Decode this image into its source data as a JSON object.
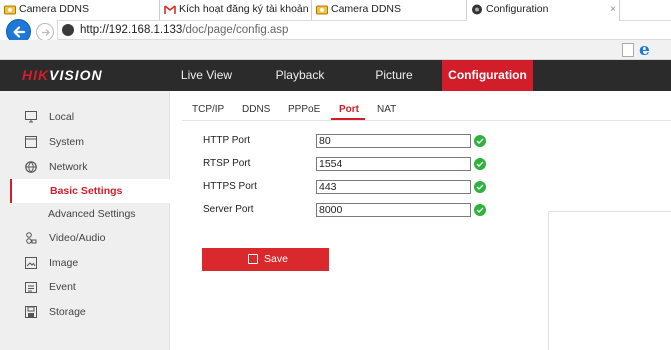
{
  "browser": {
    "url_host": "http://192.168.1.133",
    "url_path": "/doc/page/config.asp",
    "tabs": [
      {
        "label": "Camera DDNS",
        "icon": "camera-favicon"
      },
      {
        "label": "Kích hoạt đăng ký tài khoản C...",
        "icon": "gmail-favicon"
      },
      {
        "label": "Camera DDNS",
        "icon": "camera-favicon"
      },
      {
        "label": "Configuration",
        "icon": "hikvision-favicon",
        "active": true,
        "close": "×"
      }
    ]
  },
  "brand": {
    "logo_main": "HIK",
    "logo_rest": "VISION",
    "accent": "#d21e2a"
  },
  "nav": {
    "items": [
      "Live View",
      "Playback",
      "Picture",
      "Configuration"
    ],
    "active": "Configuration"
  },
  "sidebar": {
    "items": [
      {
        "label": "Local",
        "icon": "monitor-icon"
      },
      {
        "label": "System",
        "icon": "system-icon"
      },
      {
        "label": "Network",
        "icon": "globe-icon"
      },
      {
        "label": "Basic Settings",
        "active": true
      },
      {
        "label": "Advanced Settings"
      },
      {
        "label": "Video/Audio",
        "icon": "video-audio-icon"
      },
      {
        "label": "Image",
        "icon": "image-icon"
      },
      {
        "label": "Event",
        "icon": "event-icon"
      },
      {
        "label": "Storage",
        "icon": "storage-icon"
      }
    ]
  },
  "subtabs": {
    "items": [
      "TCP/IP",
      "DDNS",
      "PPPoE",
      "Port",
      "NAT"
    ],
    "active": "Port"
  },
  "form": {
    "fields": [
      {
        "label": "HTTP Port",
        "value": "80"
      },
      {
        "label": "RTSP Port",
        "value": "1554"
      },
      {
        "label": "HTTPS Port",
        "value": "443"
      },
      {
        "label": "Server Port",
        "value": "8000"
      }
    ],
    "save_label": "Save"
  }
}
